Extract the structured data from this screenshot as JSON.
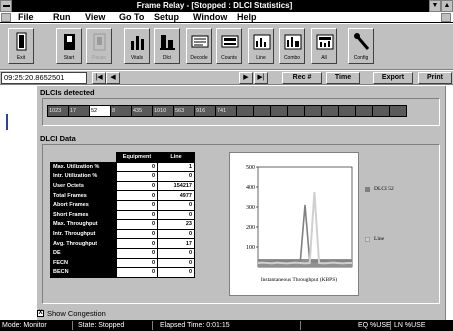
{
  "window": {
    "title": "Frame Relay - [Stopped : DLCI Statistics]"
  },
  "menu": [
    "File",
    "Run",
    "View",
    "Go To",
    "Setup",
    "Window",
    "Help"
  ],
  "toolbar": [
    {
      "label": "Exit",
      "icon": "exit-icon",
      "enabled": true
    },
    {
      "label": "Start",
      "icon": "start-icon",
      "enabled": true
    },
    {
      "label": "Pause",
      "icon": "pause-icon",
      "enabled": false
    },
    {
      "label": "Vitals",
      "icon": "vitals-icon",
      "enabled": true
    },
    {
      "label": "Dlci",
      "icon": "dlci-icon",
      "enabled": true
    },
    {
      "label": "Decode",
      "icon": "decode-icon",
      "enabled": true
    },
    {
      "label": "Counts",
      "icon": "counts-icon",
      "enabled": true
    },
    {
      "label": "Line",
      "icon": "line-icon",
      "enabled": true
    },
    {
      "label": "Combo",
      "icon": "combo-icon",
      "enabled": true
    },
    {
      "label": "All",
      "icon": "all-icon",
      "enabled": true
    },
    {
      "label": "Config",
      "icon": "config-icon",
      "enabled": true
    }
  ],
  "controls": {
    "time": "09:25:20.8652501",
    "first": "|◀",
    "prev": "◀",
    "next": "▶",
    "last": "▶|",
    "rec": "Rec #",
    "time_btn": "Time",
    "export": "Export",
    "print": "Print"
  },
  "dlci_section": {
    "title": "DLCIs detected",
    "cells": [
      "1023",
      "17",
      "52",
      "8",
      "435",
      "1010",
      "563",
      "916",
      "741"
    ]
  },
  "data_section": {
    "title": "DLCI Data",
    "headers": [
      "Equipment",
      "Line"
    ],
    "rows": [
      {
        "label": "Max. Utilization %",
        "equipment": "0",
        "line": "1"
      },
      {
        "label": "Intr. Utilization %",
        "equipment": "0",
        "line": "0"
      },
      {
        "label": "User Octets",
        "equipment": "0",
        "line": "154217"
      },
      {
        "label": "Total Frames",
        "equipment": "0",
        "line": "4977"
      },
      {
        "label": "Abort Frames",
        "equipment": "0",
        "line": "0"
      },
      {
        "label": "Short Frames",
        "equipment": "0",
        "line": "0"
      },
      {
        "label": "Max. Throughput",
        "equipment": "0",
        "line": "23"
      },
      {
        "label": "Intr. Throughput",
        "equipment": "0",
        "line": "0"
      },
      {
        "label": "Avg. Throughput",
        "equipment": "0",
        "line": "17"
      },
      {
        "label": "DE",
        "equipment": "0",
        "line": "0"
      },
      {
        "label": "FECN",
        "equipment": "0",
        "line": "0"
      },
      {
        "label": "BECN",
        "equipment": "0",
        "line": "0"
      }
    ]
  },
  "chart_data": {
    "type": "line",
    "title": "",
    "xlabel": "Instantaneous Throughput (KBPS)",
    "ylabel": "",
    "ylim": [
      0,
      500
    ],
    "yticks": [
      "500",
      "400",
      "300",
      "200",
      "100"
    ],
    "x": [
      0,
      1,
      2,
      3,
      4,
      5,
      6,
      7,
      8,
      9,
      10,
      11,
      12,
      13,
      14,
      15,
      16,
      17,
      18,
      19,
      20
    ],
    "series": [
      {
        "name": "DLCI 52",
        "color": "#808080",
        "values": [
          35,
          30,
          28,
          30,
          32,
          30,
          28,
          30,
          30,
          28,
          310,
          30,
          28,
          30,
          30,
          28,
          30,
          30,
          28,
          30,
          30
        ]
      },
      {
        "name": "Line",
        "color": "#d0d0d0",
        "values": [
          20,
          22,
          20,
          18,
          22,
          20,
          18,
          20,
          22,
          20,
          18,
          20,
          375,
          20,
          18,
          20,
          22,
          20,
          18,
          20,
          20
        ]
      }
    ],
    "grid": false,
    "legend": "right"
  },
  "checkbox": {
    "label": "Show Congestion",
    "checked": true,
    "mark": "X"
  },
  "status": {
    "mode": "Mode: Monitor",
    "state": "State: Stopped",
    "elapsed": "Elapsed Time: 0:01:15",
    "eq": "EQ %USE",
    "ln": "LN %USE"
  }
}
